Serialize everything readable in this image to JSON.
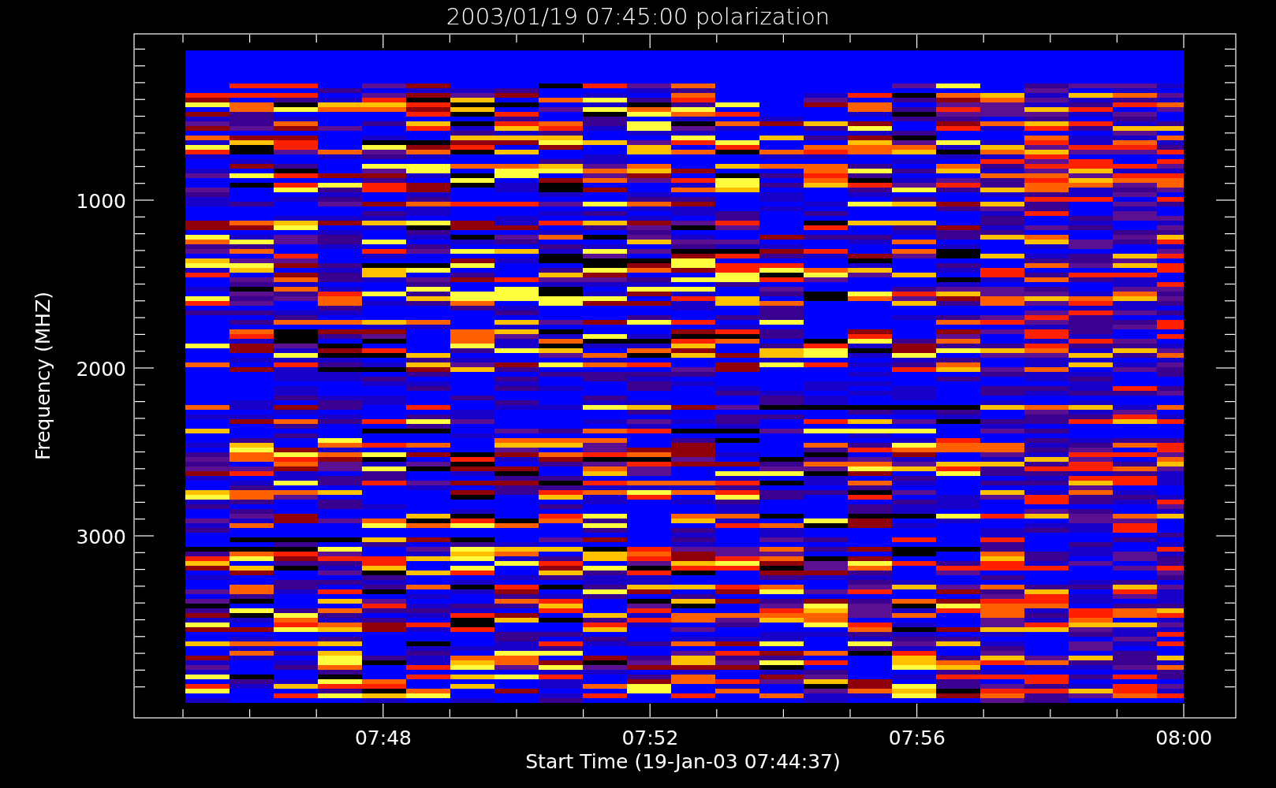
{
  "plot": {
    "title": "2003/01/19 07:45:00 polarization",
    "y_axis": {
      "label": "Frequency (MHZ)",
      "ticks": [
        "1000",
        "2000",
        "3000"
      ]
    },
    "x_axis": {
      "label": "Start Time (19-Jan-03 07:44:37)",
      "ticks": [
        "07:48",
        "07:52",
        "07:56",
        "08:00"
      ]
    }
  }
}
